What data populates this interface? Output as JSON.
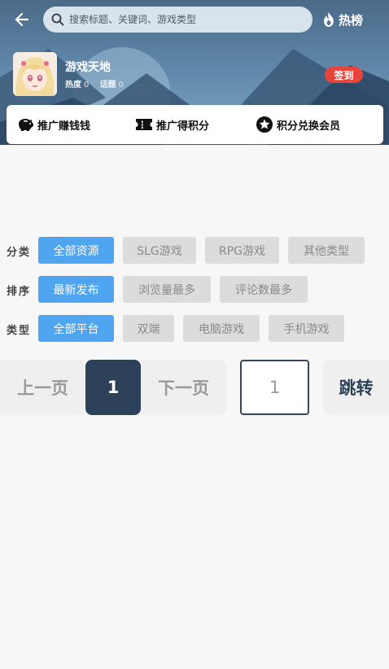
{
  "header": {
    "search_placeholder": "搜索标题、关键词、游戏类型",
    "hot_label": "热榜"
  },
  "game": {
    "name": "游戏天地",
    "heat_label": "热度",
    "heat_value": "0",
    "topic_label": "话题",
    "topic_value": "0",
    "signin_label": "签到"
  },
  "promo": [
    {
      "label": "推广赚钱钱",
      "icon": "piggy-bank-icon"
    },
    {
      "label": "推广得积分",
      "icon": "ticket-icon"
    },
    {
      "label": "积分兑换会员",
      "icon": "star-badge-icon"
    }
  ],
  "filters": {
    "category": {
      "label": "分类",
      "options": [
        "全部资源",
        "SLG游戏",
        "RPG游戏",
        "其他类型"
      ],
      "selected": "全部资源"
    },
    "sort": {
      "label": "排序",
      "options": [
        "最新发布",
        "浏览量最多",
        "评论数最多"
      ],
      "selected": "最新发布"
    },
    "type": {
      "label": "类型",
      "options": [
        "全部平台",
        "双端",
        "电脑游戏",
        "手机游戏"
      ],
      "selected": "全部平台"
    }
  },
  "pagination": {
    "prev_label": "上一页",
    "current_page": "1",
    "next_label": "下一页",
    "input_value": "1",
    "jump_label": "跳转"
  },
  "colors": {
    "accent": "#4fa5f0",
    "signin": "#e8443a",
    "page_active": "#2d4159"
  }
}
